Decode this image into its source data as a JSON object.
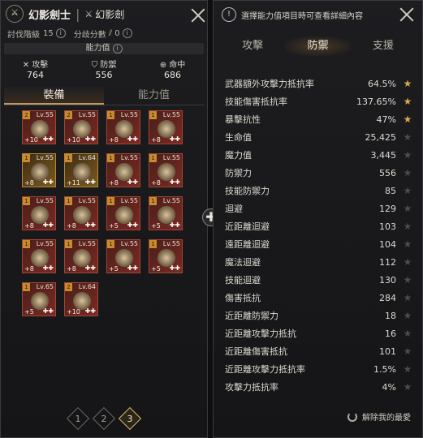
{
  "left": {
    "class_name": "幻影劍士",
    "sub_name": "幻影劍",
    "rank_label": "討伐階級",
    "rank_value": "15",
    "branch_label": "分歧分數",
    "branch_value": "0",
    "ability_label": "能力值",
    "stats": [
      {
        "icon": "sword-icon",
        "label": "攻擊",
        "value": "764"
      },
      {
        "icon": "shield-icon",
        "label": "防禦",
        "value": "556"
      },
      {
        "icon": "target-icon",
        "label": "命中",
        "value": "686"
      }
    ],
    "tabs": [
      "裝備",
      "能力值"
    ],
    "items": [
      {
        "tier": "2",
        "lv": "Lv.55",
        "plus": "+10",
        "style": "red"
      },
      {
        "tier": "2",
        "lv": "Lv.55",
        "plus": "+10",
        "style": "red"
      },
      {
        "tier": "1",
        "lv": "Lv.55",
        "plus": "+8",
        "style": "red"
      },
      {
        "tier": "1",
        "lv": "Lv.55",
        "plus": "+8",
        "style": "red"
      },
      {
        "tier": "1",
        "lv": "Lv.55",
        "plus": "+8",
        "style": "gold"
      },
      {
        "tier": "1",
        "lv": "Lv.64",
        "plus": "+11",
        "style": "gold"
      },
      {
        "tier": "1",
        "lv": "Lv.55",
        "plus": "+8",
        "style": "red"
      },
      {
        "tier": "1",
        "lv": "Lv.55",
        "plus": "+8",
        "style": "red"
      },
      {
        "tier": "1",
        "lv": "Lv.55",
        "plus": "+8",
        "style": "red"
      },
      {
        "tier": "1",
        "lv": "Lv.55",
        "plus": "+8",
        "style": "red"
      },
      {
        "tier": "1",
        "lv": "Lv.55",
        "plus": "+5",
        "style": "red"
      },
      {
        "tier": "1",
        "lv": "Lv.55",
        "plus": "+5",
        "style": "red"
      },
      {
        "tier": "1",
        "lv": "Lv.55",
        "plus": "+8",
        "style": "red"
      },
      {
        "tier": "1",
        "lv": "Lv.55",
        "plus": "+8",
        "style": "red"
      },
      {
        "tier": "1",
        "lv": "Lv.55",
        "plus": "+5",
        "style": "red"
      },
      {
        "tier": "1",
        "lv": "Lv.55",
        "plus": "+5",
        "style": "red"
      },
      {
        "tier": "1",
        "lv": "Lv.65",
        "plus": "+5",
        "style": "red"
      },
      {
        "tier": "2",
        "lv": "Lv.64",
        "plus": "+10",
        "style": "red"
      }
    ],
    "pages": [
      "1",
      "2",
      "3"
    ],
    "active_page": 2
  },
  "right": {
    "header": "選擇能力值項目時可查看詳細內容",
    "tabs": [
      "攻擊",
      "防禦",
      "支援"
    ],
    "active_tab": 1,
    "rows": [
      {
        "name": "武器額外攻擊力抵抗率",
        "value": "64.5%",
        "star": true
      },
      {
        "name": "技能傷害抵抗率",
        "value": "137.65%",
        "star": true
      },
      {
        "name": "暴擊抗性",
        "value": "47%",
        "star": true
      },
      {
        "name": "生命值",
        "value": "25,425",
        "star": false
      },
      {
        "name": "魔力值",
        "value": "3,445",
        "star": false
      },
      {
        "name": "防禦力",
        "value": "556",
        "star": false
      },
      {
        "name": "技能防禦力",
        "value": "85",
        "star": false
      },
      {
        "name": "迴避",
        "value": "129",
        "star": false
      },
      {
        "name": "近距離迴避",
        "value": "103",
        "star": false
      },
      {
        "name": "遠距離迴避",
        "value": "104",
        "star": false
      },
      {
        "name": "魔法迴避",
        "value": "112",
        "star": false
      },
      {
        "name": "技能迴避",
        "value": "130",
        "star": false
      },
      {
        "name": "傷害抵抗",
        "value": "284",
        "star": false
      },
      {
        "name": "近距離防禦力",
        "value": "18",
        "star": false
      },
      {
        "name": "近距離攻擊力抵抗",
        "value": "16",
        "star": false
      },
      {
        "name": "近距離傷害抵抗",
        "value": "101",
        "star": false
      },
      {
        "name": "近距離攻擊力抵抗率",
        "value": "1.5%",
        "star": false
      },
      {
        "name": "攻擊力抵抗率",
        "value": "4%",
        "star": false
      }
    ],
    "footer": "解除我的最愛"
  },
  "expand_symbol": "✚"
}
